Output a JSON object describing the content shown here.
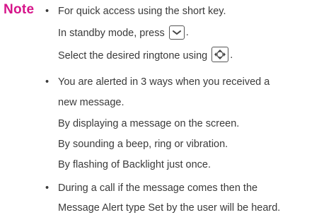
{
  "note_label": "Note",
  "bullet_char": "•",
  "items": [
    {
      "lines": [
        "For quick access using the short key.",
        "In standby mode, press",
        "Select the desired ringtone using"
      ],
      "line_end": "."
    },
    {
      "lines": [
        "You are alerted in 3 ways when you received a",
        "new message.",
        "By displaying a message on the screen.",
        "By sounding a beep, ring or vibration.",
        "By flashing of Backlight just once."
      ]
    },
    {
      "lines": [
        "During a call if the message comes then the",
        "Message Alert type Set by the user will be heard."
      ]
    }
  ],
  "icons": {
    "down_key": "down-arrow-key-icon",
    "nav_key": "navigation-key-icon"
  },
  "colors": {
    "note_label": "#d6148a",
    "text": "#3a3a3a"
  }
}
